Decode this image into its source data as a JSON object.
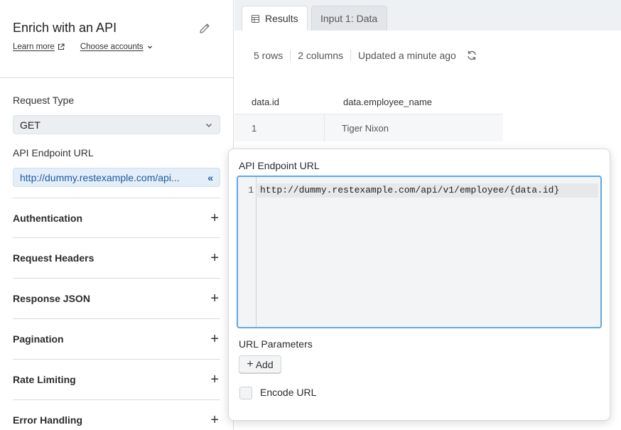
{
  "left": {
    "title": "Enrich with an API",
    "learn_more": "Learn more",
    "choose_accounts": "Choose accounts",
    "request_type_label": "Request Type",
    "request_type_value": "GET",
    "endpoint_label": "API Endpoint URL",
    "endpoint_value": "http://dummy.restexample.com/api...",
    "sections": [
      {
        "label": "Authentication"
      },
      {
        "label": "Request Headers"
      },
      {
        "label": "Response JSON"
      },
      {
        "label": "Pagination"
      },
      {
        "label": "Rate Limiting"
      },
      {
        "label": "Error Handling"
      }
    ]
  },
  "tabs": {
    "results": "Results",
    "input": "Input 1: Data"
  },
  "stats": {
    "rows": "5 rows",
    "columns": "2 columns",
    "updated": "Updated a minute ago"
  },
  "table": {
    "headers": [
      "data.id",
      "data.employee_name"
    ],
    "rows": [
      [
        "1",
        "Tiger Nixon"
      ]
    ]
  },
  "popover": {
    "label": "API Endpoint URL",
    "line_number": "1",
    "code": "http://dummy.restexample.com/api/v1/employee/{data.id}",
    "url_params_label": "URL Parameters",
    "add_label": "Add",
    "encode_label": "Encode URL"
  },
  "colors": {
    "accent": "#5fa8e8",
    "link_blue": "#1b5aa6",
    "url_field_bg": "#e3eef8"
  }
}
